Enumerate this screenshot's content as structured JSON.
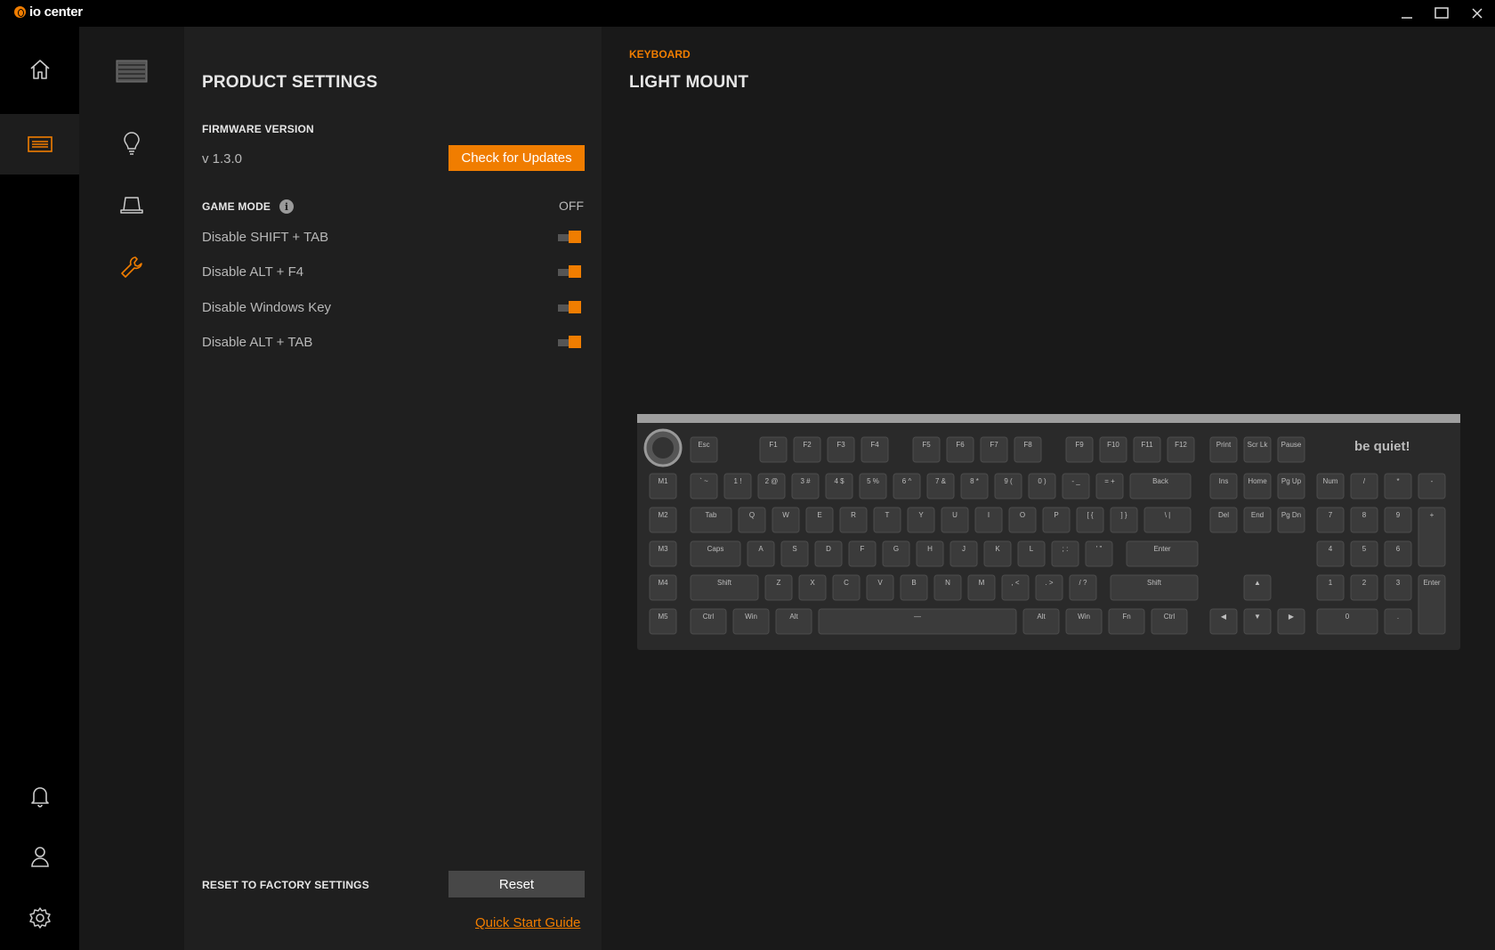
{
  "app": {
    "name": "io center"
  },
  "colors": {
    "accent": "#f07d00",
    "background": "#1d1d1d",
    "rail": "#000000"
  },
  "nav_rail": {
    "top_items": [
      {
        "icon": "home-icon"
      },
      {
        "icon": "keyboard-icon",
        "active": true
      }
    ],
    "bottom_items": [
      {
        "icon": "bell-icon"
      },
      {
        "icon": "user-icon"
      },
      {
        "icon": "gear-icon"
      }
    ]
  },
  "sub_nav": {
    "items": [
      {
        "icon": "keyboard-thumbnail"
      },
      {
        "icon": "lightbulb-icon"
      },
      {
        "icon": "laptop-icon"
      },
      {
        "icon": "wrench-icon",
        "active": true
      }
    ]
  },
  "panel": {
    "title": "PRODUCT SETTINGS",
    "firmware": {
      "label": "FIRMWARE VERSION",
      "version": "v 1.3.0",
      "button": "Check for Updates"
    },
    "game_mode": {
      "label": "GAME MODE",
      "status": "OFF",
      "options": [
        {
          "label": "Disable SHIFT + TAB",
          "enabled": true
        },
        {
          "label": "Disable ALT + F4",
          "enabled": true
        },
        {
          "label": "Disable Windows Key",
          "enabled": true
        },
        {
          "label": "Disable ALT + TAB",
          "enabled": true
        }
      ]
    },
    "reset": {
      "label": "RESET TO FACTORY SETTINGS",
      "button": "Reset"
    },
    "guide_link": "Quick Start Guide"
  },
  "main": {
    "category": "KEYBOARD",
    "device": "LIGHT MOUNT"
  },
  "keyboard": {
    "brand": "be quiet!",
    "rows": [
      [
        "Esc",
        "F1",
        "F2",
        "F3",
        "F4",
        "F5",
        "F6",
        "F7",
        "F8",
        "F9",
        "F10",
        "F11",
        "F12",
        "Print",
        "Scr Lk",
        "Pause"
      ],
      [
        "M1",
        "` ~",
        "1 !",
        "2 @",
        "3 #",
        "4 $",
        "5 %",
        "6 ^",
        "7 &",
        "8 *",
        "9 (",
        "0 )",
        "- _",
        "= +",
        "Back",
        "Ins",
        "Home",
        "Pg Up",
        "Num",
        "/",
        "*",
        "-"
      ],
      [
        "M2",
        "Tab",
        "Q",
        "W",
        "E",
        "R",
        "T",
        "Y",
        "U",
        "I",
        "O",
        "P",
        "[ {",
        "] }",
        "\\ |",
        "Del",
        "End",
        "Pg Dn",
        "7",
        "8",
        "9",
        "+"
      ],
      [
        "M3",
        "Caps",
        "A",
        "S",
        "D",
        "F",
        "G",
        "H",
        "J",
        "K",
        "L",
        "; :",
        "' \"",
        "Enter",
        "4",
        "5",
        "6"
      ],
      [
        "M4",
        "Shift",
        "Z",
        "X",
        "C",
        "V",
        "B",
        "N",
        "M",
        ", <",
        ". >",
        "/ ?",
        "Shift",
        "▲",
        "1",
        "2",
        "3",
        "Enter"
      ],
      [
        "M5",
        "Ctrl",
        "Win",
        "Alt",
        "—",
        "Alt",
        "Win",
        "Fn",
        "Ctrl",
        "◀",
        "▼",
        "▶",
        "0",
        "."
      ]
    ]
  }
}
